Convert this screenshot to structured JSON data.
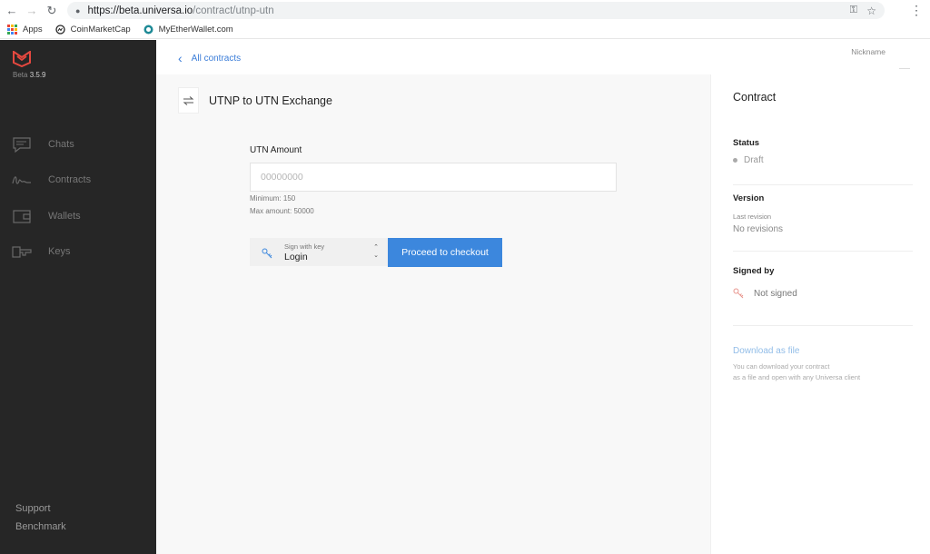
{
  "browser": {
    "url_host": "https://beta.universa.io",
    "url_path": "/contract/utnp-utn",
    "bookmarks": [
      {
        "label": "Apps",
        "icon": "apps-grid-icon"
      },
      {
        "label": "CoinMarketCap",
        "icon": "coinmarketcap-icon"
      },
      {
        "label": "MyEtherWallet.com",
        "icon": "myetherwallet-icon"
      }
    ]
  },
  "sidebar": {
    "version_prefix": "Beta",
    "version": "3.5.9",
    "items": [
      {
        "label": "Chats",
        "icon": "chat-icon"
      },
      {
        "label": "Contracts",
        "icon": "signature-icon"
      },
      {
        "label": "Wallets",
        "icon": "wallet-icon"
      },
      {
        "label": "Keys",
        "icon": "key-icon"
      }
    ],
    "footer": [
      "Support",
      "Benchmark"
    ]
  },
  "topbar": {
    "back_label": "All contracts",
    "nickname_label": "Nickname"
  },
  "main": {
    "title": "UTNP to UTN Exchange",
    "amount_label": "UTN Amount",
    "amount_placeholder": "00000000",
    "minimum": "Minimum: 150",
    "max": "Max amount: 50000",
    "sign_caption": "Sign with key",
    "sign_value": "Login",
    "checkout_label": "Proceed to checkout"
  },
  "panel": {
    "title": "Contract",
    "status_label": "Status",
    "status_value": "Draft",
    "version_label": "Version",
    "version_sub": "Last revision",
    "version_value": "No revisions",
    "signed_label": "Signed by",
    "signed_value": "Not signed",
    "download_label": "Download as file",
    "download_desc_1": "You can download your contract",
    "download_desc_2": "as a file and open with any Universa client"
  },
  "colors": {
    "accent": "#3c87dd",
    "sidebar_bg": "#262626",
    "logo_red": "#e5483f"
  }
}
